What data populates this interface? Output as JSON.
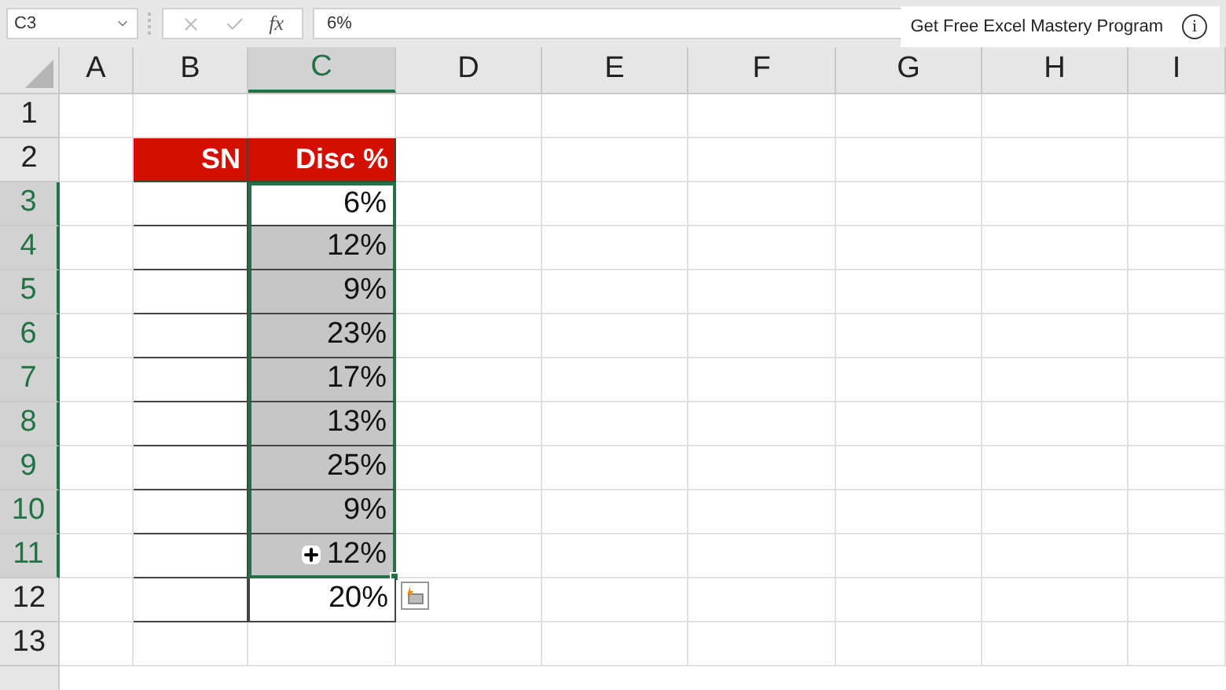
{
  "name_box": "C3",
  "formula_bar": {
    "fx": "fx",
    "value": "6%"
  },
  "promo": {
    "text": "Get Free Excel Mastery Program",
    "icon": "i"
  },
  "columns": [
    {
      "label": "A",
      "selected": false
    },
    {
      "label": "B",
      "selected": false
    },
    {
      "label": "C",
      "selected": true
    },
    {
      "label": "D",
      "selected": false
    },
    {
      "label": "E",
      "selected": false
    },
    {
      "label": "F",
      "selected": false
    },
    {
      "label": "G",
      "selected": false
    },
    {
      "label": "H",
      "selected": false
    },
    {
      "label": "I",
      "selected": false
    }
  ],
  "rows": [
    {
      "number": "1",
      "selected": false
    },
    {
      "number": "2",
      "selected": false,
      "sn": {
        "kind": "header",
        "text": "SN"
      },
      "disc": {
        "kind": "header",
        "text": "Disc %"
      }
    },
    {
      "number": "3",
      "selected": true,
      "sn": {
        "kind": "blank"
      },
      "disc": {
        "kind": "value",
        "text": "6%",
        "selected": false,
        "active": true
      }
    },
    {
      "number": "4",
      "selected": true,
      "sn": {
        "kind": "blank"
      },
      "disc": {
        "kind": "value",
        "text": "12%",
        "selected": true,
        "active": false
      }
    },
    {
      "number": "5",
      "selected": true,
      "sn": {
        "kind": "blank"
      },
      "disc": {
        "kind": "value",
        "text": "9%",
        "selected": true,
        "active": false
      }
    },
    {
      "number": "6",
      "selected": true,
      "sn": {
        "kind": "blank"
      },
      "disc": {
        "kind": "value",
        "text": "23%",
        "selected": true,
        "active": false
      }
    },
    {
      "number": "7",
      "selected": true,
      "sn": {
        "kind": "blank"
      },
      "disc": {
        "kind": "value",
        "text": "17%",
        "selected": true,
        "active": false
      }
    },
    {
      "number": "8",
      "selected": true,
      "sn": {
        "kind": "blank"
      },
      "disc": {
        "kind": "value",
        "text": "13%",
        "selected": true,
        "active": false
      }
    },
    {
      "number": "9",
      "selected": true,
      "sn": {
        "kind": "blank"
      },
      "disc": {
        "kind": "value",
        "text": "25%",
        "selected": true,
        "active": false
      }
    },
    {
      "number": "10",
      "selected": true,
      "sn": {
        "kind": "blank"
      },
      "disc": {
        "kind": "value",
        "text": "9%",
        "selected": true,
        "active": false
      }
    },
    {
      "number": "11",
      "selected": true,
      "sn": {
        "kind": "blank"
      },
      "disc": {
        "kind": "value",
        "text": "12%",
        "selected": true,
        "active": false,
        "cursor": true
      }
    },
    {
      "number": "12",
      "selected": false,
      "sn": {
        "kind": "blank"
      },
      "disc": {
        "kind": "value",
        "text": "20%",
        "selected": false,
        "active": false,
        "quick_analysis": true
      }
    },
    {
      "number": "13",
      "selected": false
    }
  ]
}
